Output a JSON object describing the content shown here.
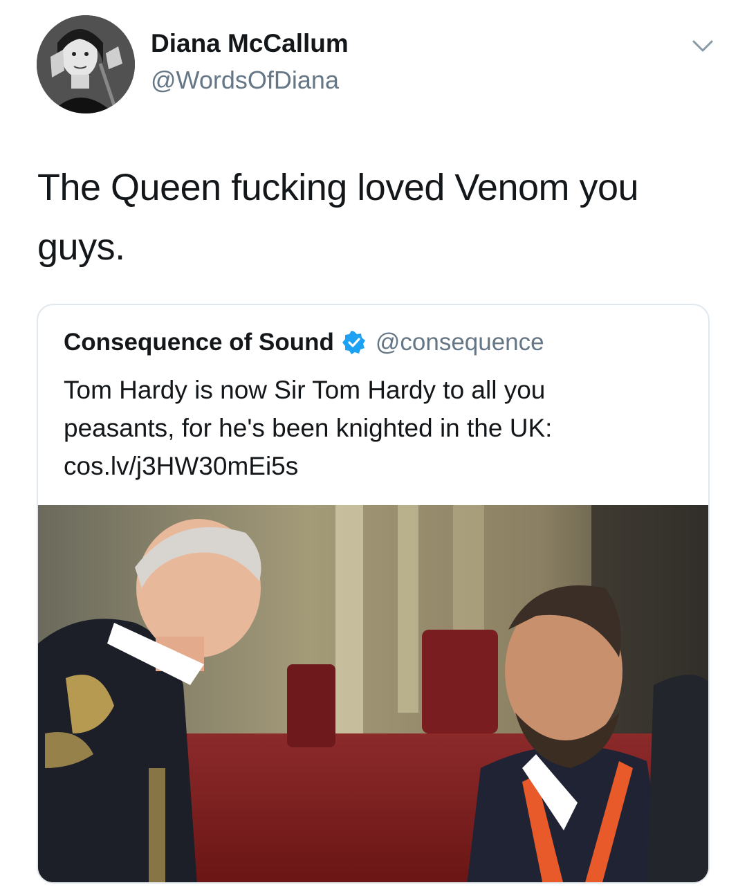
{
  "tweet": {
    "author": {
      "display_name": "Diana McCallum",
      "handle": "@WordsOfDiana",
      "avatar_icon": "profile-photo"
    },
    "menu_icon": "chevron-down-icon",
    "text_line_1": "The Queen fucking loved Venom you",
    "text_line_2": "guys."
  },
  "quoted_tweet": {
    "author": {
      "display_name": "Consequence of Sound",
      "verified": true,
      "verified_icon": "verified-badge-icon",
      "handle": "@consequence"
    },
    "text_lines": [
      "Tom Hardy is now Sir Tom Hardy to all you",
      "peasants, for he's been knighted in the UK:",
      "cos.lv/j3HW30mEi5s"
    ],
    "media_icon": "photo"
  },
  "colors": {
    "text": "#14171a",
    "secondary_text": "#657786",
    "border": "#e1e8ed",
    "verified_blue": "#1da1f2",
    "background": "#ffffff"
  }
}
